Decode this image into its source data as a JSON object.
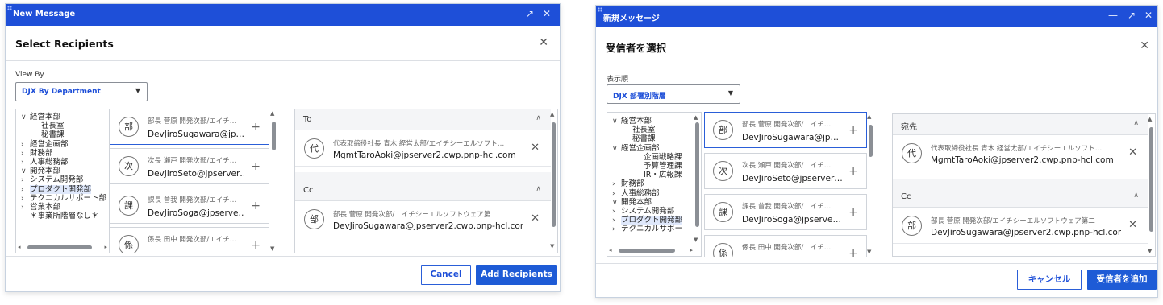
{
  "en": {
    "window_title": "New Message",
    "dialog_title": "Select Recipients",
    "view_by_label": "View By",
    "view_by_value": "DJX By Department",
    "tree": [
      {
        "label": "経営本部",
        "arrow": "v"
      },
      {
        "label": "社長室",
        "arrow": ""
      },
      {
        "label": "秘書課",
        "arrow": ""
      },
      {
        "label": "経営企画部",
        "arrow": ">"
      },
      {
        "label": "財務部",
        "arrow": ">"
      },
      {
        "label": "人事総務部",
        "arrow": ">"
      },
      {
        "label": "開発本部",
        "arrow": "v"
      },
      {
        "label": "システム開発部",
        "arrow": ">"
      },
      {
        "label": "プロダクト開発部",
        "arrow": ">",
        "selected": true
      },
      {
        "label": "テクニカルサポート部",
        "arrow": ">"
      },
      {
        "label": "営業本部",
        "arrow": ">"
      },
      {
        "label": "＊事業所階層なし＊",
        "arrow": ""
      }
    ],
    "candidates": [
      {
        "avatar": "部",
        "sub": "部長 菅原 開発次部/エイチ…",
        "main": "DevJiroSugawara@jp…"
      },
      {
        "avatar": "次",
        "sub": "次長 瀬戸 開発次部/エイチ…",
        "main": "DevJiroSeto@jpserver…"
      },
      {
        "avatar": "課",
        "sub": "課長 曾我 開発次部/エイチ…",
        "main": "DevJiroSoga@jpserve…"
      },
      {
        "avatar": "係",
        "sub": "係長 田中 開発次部/エイチ…",
        "main": ""
      }
    ],
    "to_label": "To",
    "to": [
      {
        "avatar": "代",
        "sub": "代表取締役社長 青木 経営太部/エイチシーエルソフト…",
        "main": "MgmtTaroAoki@jpserver2.cwp.pnp-hcl.com"
      }
    ],
    "cc_label": "Cc",
    "cc": [
      {
        "avatar": "部",
        "sub": "部長 菅原 開発次部/エイチシーエルソフトウェア第二",
        "main": "DevJiroSugawara@jpserver2.cwp.pnp-hcl.com"
      }
    ],
    "cancel": "Cancel",
    "add": "Add Recipients"
  },
  "ja": {
    "window_title": "新規メッセージ",
    "dialog_title": "受信者を選択",
    "view_by_label": "表示順",
    "view_by_value": "DJX 部署別階層",
    "tree": [
      {
        "label": "経営本部",
        "arrow": "v"
      },
      {
        "label": "社長室",
        "arrow": ""
      },
      {
        "label": "秘書課",
        "arrow": ""
      },
      {
        "label": "経営企画部",
        "arrow": "v"
      },
      {
        "label": "企画戦略課",
        "arrow": ""
      },
      {
        "label": "予算管理課",
        "arrow": ""
      },
      {
        "label": "IR・広報課",
        "arrow": ""
      },
      {
        "label": "財務部",
        "arrow": ">"
      },
      {
        "label": "人事総務部",
        "arrow": ">"
      },
      {
        "label": "開発本部",
        "arrow": "v"
      },
      {
        "label": "システム開発部",
        "arrow": ">"
      },
      {
        "label": "プロダクト開発部",
        "arrow": ">",
        "selected": true
      },
      {
        "label": "テクニカルサポー",
        "arrow": ">"
      }
    ],
    "candidates": [
      {
        "avatar": "部",
        "sub": "部長 菅原 開発次部/エイチ…",
        "main": "DevJiroSugawara@jp…"
      },
      {
        "avatar": "次",
        "sub": "次長 瀬戸 開発次部/エイチ…",
        "main": "DevJiroSeto@jpserver…"
      },
      {
        "avatar": "課",
        "sub": "課長 曾我 開発次部/エイチ…",
        "main": "DevJiroSoga@jpserve…"
      },
      {
        "avatar": "係",
        "sub": "係長 田中 開発次部/エイチ…",
        "main": ""
      }
    ],
    "to_label": "宛先",
    "to": [
      {
        "avatar": "代",
        "sub": "代表取締役社長 青木 経営太部/エイチシーエルソフト…",
        "main": "MgmtTaroAoki@jpserver2.cwp.pnp-hcl.com"
      }
    ],
    "cc_label": "Cc",
    "cc": [
      {
        "avatar": "部",
        "sub": "部長 菅原 開発次部/エイチシーエルソフトウェア第二",
        "main": "DevJiroSugawara@jpserver2.cwp.pnp-hcl.com"
      }
    ],
    "cancel": "キャンセル",
    "add": "受信者を追加"
  },
  "icons": {
    "minimize": "minimize-icon",
    "expand": "expand-icon",
    "close": "close-icon",
    "plus": "plus-icon",
    "remove": "remove-icon",
    "chevron_up": "chevron-up-icon",
    "caret_down": "caret-down-icon"
  },
  "colors": {
    "titlebar": "#1e4fd8",
    "accent": "#1e5bd6",
    "selection": "#dfe8fb"
  }
}
